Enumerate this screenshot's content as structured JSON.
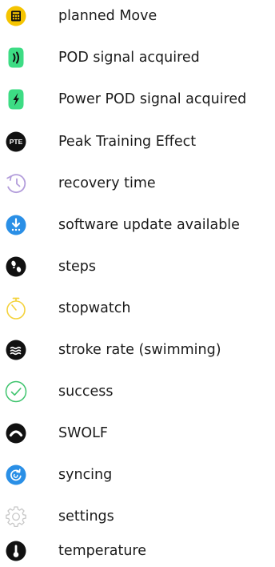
{
  "icons": [
    {
      "icon": "planned-move-icon",
      "label": "planned Move",
      "color": "#f5c400"
    },
    {
      "icon": "pod-icon",
      "label": "POD signal acquired",
      "color": "#3ddc84"
    },
    {
      "icon": "power-pod-icon",
      "label": "Power POD signal acquired",
      "color": "#3ddc84"
    },
    {
      "icon": "pte-icon",
      "label": "Peak Training Effect",
      "color": "#111111",
      "icon_text": "PTE"
    },
    {
      "icon": "recovery-time-icon",
      "label": "recovery time",
      "color": "#b39ddb"
    },
    {
      "icon": "software-update-icon",
      "label": "software update available",
      "color": "#2a8fe6"
    },
    {
      "icon": "steps-icon",
      "label": "steps",
      "color": "#111111"
    },
    {
      "icon": "stopwatch-icon",
      "label": "stopwatch",
      "color": "#f4d23c"
    },
    {
      "icon": "stroke-rate-icon",
      "label": "stroke rate (swimming)",
      "color": "#111111"
    },
    {
      "icon": "success-icon",
      "label": "success",
      "color": "#3ec46d"
    },
    {
      "icon": "swolf-icon",
      "label": "SWOLF",
      "color": "#111111"
    },
    {
      "icon": "syncing-icon",
      "label": "syncing",
      "color": "#2a8fe6"
    },
    {
      "icon": "settings-icon",
      "label": "settings",
      "color": "#c8c8c8"
    },
    {
      "icon": "temperature-icon",
      "label": "temperature",
      "color": "#111111"
    }
  ]
}
